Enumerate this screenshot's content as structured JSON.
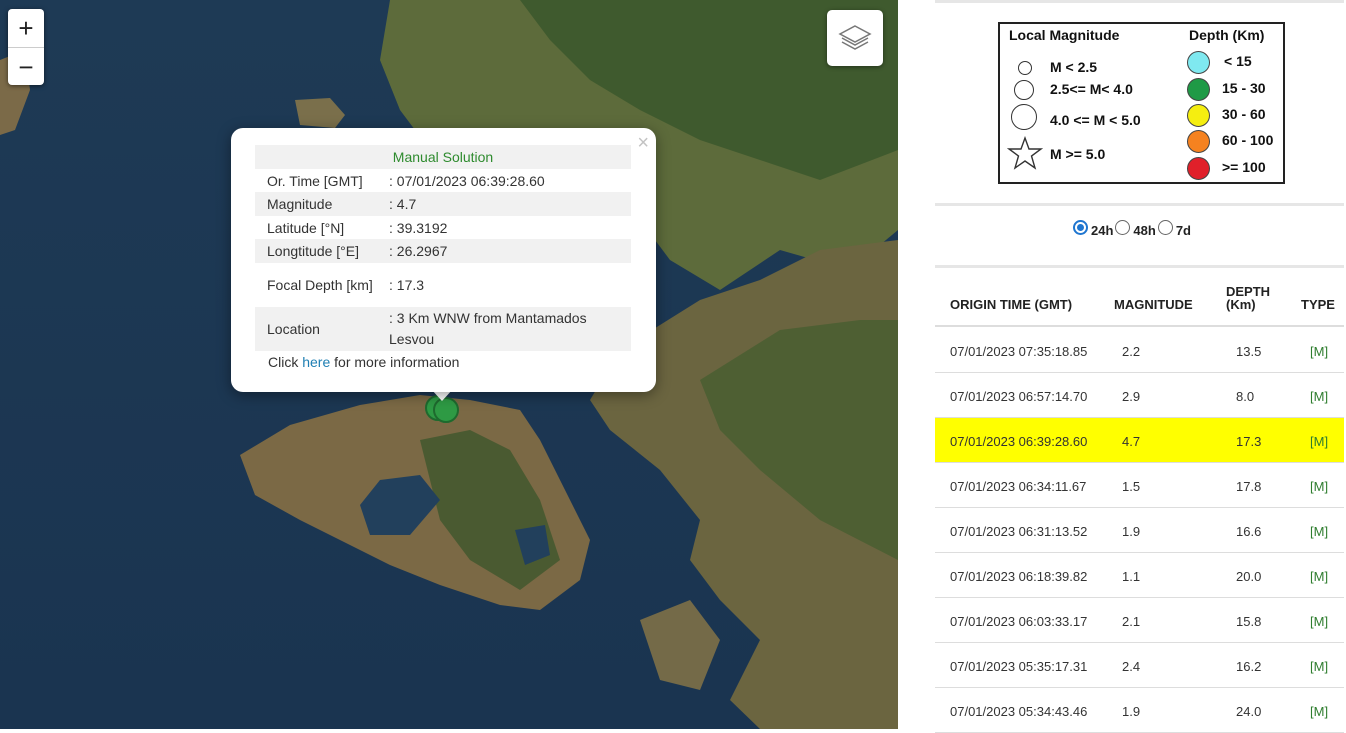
{
  "map": {
    "zoom_in": "+",
    "zoom_out": "−",
    "layers_icon": "layers-icon",
    "marker_color": "#2e9a44",
    "popup": {
      "close": "×",
      "title": "Manual Solution",
      "rows": [
        {
          "key": "Or. Time [GMT]",
          "value": ": 07/01/2023 06:39:28.60"
        },
        {
          "key": "Magnitude",
          "value": ": 4.7"
        },
        {
          "key": "Latitude [°N]",
          "value": ": 39.3192"
        },
        {
          "key": "Longtitude [°E]",
          "value": ": 26.2967"
        },
        {
          "key": "Focal Depth [km]",
          "value": ": 17.3"
        },
        {
          "key": "Location",
          "value": ": 3 Km WNW from Mantamados Lesvou"
        }
      ],
      "more_prefix": "Click ",
      "more_link": "here",
      "more_suffix": " for more information"
    }
  },
  "legend": {
    "magnitude_title": "Local Magnitude",
    "depth_title": "Depth (Km)",
    "magnitudes": [
      "M < 2.5",
      "2.5<= M< 4.0",
      "4.0 <= M < 5.0",
      "M >= 5.0"
    ],
    "depths": [
      {
        "label": "< 15",
        "color": "#7fe9f0"
      },
      {
        "label": "15 - 30",
        "color": "#1f9a46"
      },
      {
        "label": "30 - 60",
        "color": "#f5ee10"
      },
      {
        "label": "60 - 100",
        "color": "#f58220"
      },
      {
        "label": ">= 100",
        "color": "#e0202a"
      }
    ]
  },
  "period": {
    "options": [
      "24h",
      "48h",
      "7d"
    ],
    "selected": "24h"
  },
  "table": {
    "headers": {
      "time": "ORIGIN TIME (GMT)",
      "magnitude": "MAGNITUDE",
      "depth": "DEPTH",
      "depth_unit": "(Km)",
      "type": "TYPE"
    },
    "highlight_color": "#ffff00",
    "rows": [
      {
        "time": "07/01/2023 07:35:18.85",
        "mag": "2.2",
        "depth": "13.5",
        "type": "[M]"
      },
      {
        "time": "07/01/2023 06:57:14.70",
        "mag": "2.9",
        "depth": "8.0",
        "type": "[M]"
      },
      {
        "time": "07/01/2023 06:39:28.60",
        "mag": "4.7",
        "depth": "17.3",
        "type": "[M]",
        "highlighted": true
      },
      {
        "time": "07/01/2023 06:34:11.67",
        "mag": "1.5",
        "depth": "17.8",
        "type": "[M]"
      },
      {
        "time": "07/01/2023 06:31:13.52",
        "mag": "1.9",
        "depth": "16.6",
        "type": "[M]"
      },
      {
        "time": "07/01/2023 06:18:39.82",
        "mag": "1.1",
        "depth": "20.0",
        "type": "[M]"
      },
      {
        "time": "07/01/2023 06:03:33.17",
        "mag": "2.1",
        "depth": "15.8",
        "type": "[M]"
      },
      {
        "time": "07/01/2023 05:35:17.31",
        "mag": "2.4",
        "depth": "16.2",
        "type": "[M]"
      },
      {
        "time": "07/01/2023 05:34:43.46",
        "mag": "1.9",
        "depth": "24.0",
        "type": "[M]"
      }
    ]
  }
}
